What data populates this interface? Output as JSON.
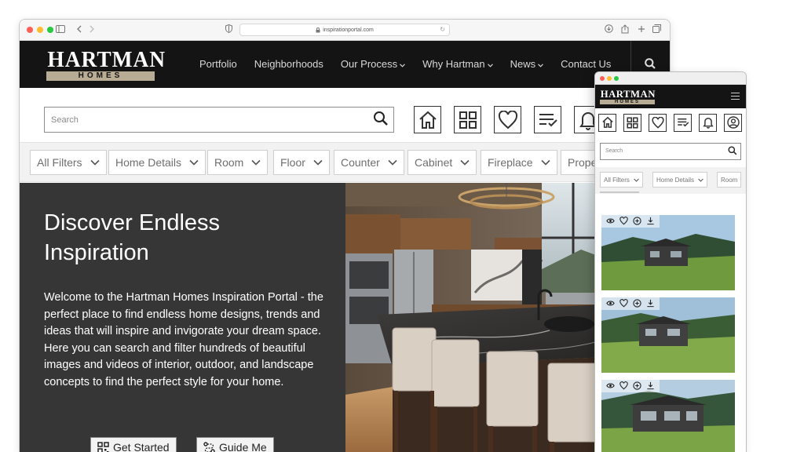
{
  "browser": {
    "url": "inspirationportal.com"
  },
  "brand": {
    "name_top": "HARTMAN",
    "name_bottom": "HOMES",
    "accent": "#b8ac94",
    "nav_bg": "#141414",
    "hero_bg": "#363636"
  },
  "nav": {
    "items": [
      {
        "label": "Portfolio",
        "dropdown": false
      },
      {
        "label": "Neighborhoods",
        "dropdown": false
      },
      {
        "label": "Our Process",
        "dropdown": true
      },
      {
        "label": "Why Hartman",
        "dropdown": true
      },
      {
        "label": "News",
        "dropdown": true
      },
      {
        "label": "Contact Us",
        "dropdown": false
      }
    ],
    "search_icon": "search-icon"
  },
  "search": {
    "placeholder": "Search"
  },
  "tools": [
    "home-icon",
    "grid-icon",
    "heart-icon",
    "list-check-icon",
    "bell-icon"
  ],
  "filters": [
    "All Filters",
    "Home Details",
    "Room",
    "Floor",
    "Counter",
    "Cabinet",
    "Fireplace",
    "Prope"
  ],
  "hero": {
    "title": "Discover Endless Inspiration",
    "body": "Welcome to the Hartman Homes Inspiration Portal - the perfect place to find endless home designs, trends and ideas that will inspire and invigorate your dream space. Here you can search and filter hundreds of beautiful images and videos of interior, outdoor, and landscape concepts to find the perfect style for your home.",
    "buttons": [
      {
        "label": "Get Started",
        "icon": "qr-grid-icon"
      },
      {
        "label": "Guide Me",
        "icon": "route-icon"
      }
    ]
  },
  "mobile": {
    "search_placeholder": "Search",
    "filters": [
      "All Filters",
      "Home Details",
      "Room"
    ],
    "tools": [
      "home-icon",
      "grid-icon",
      "heart-icon",
      "list-check-icon",
      "bell-icon",
      "user-icon"
    ],
    "card_actions": [
      "eye-icon",
      "heart-icon",
      "plus-circle-icon",
      "download-icon"
    ],
    "card_count": 3
  }
}
